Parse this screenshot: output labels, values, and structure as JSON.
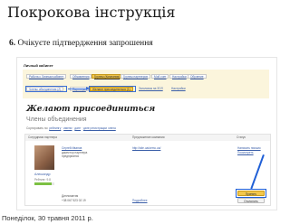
{
  "slide": {
    "title": "Покрокова інструкція",
    "step_number": "6.",
    "step_text": "Очікуєте підтвердження запрошення",
    "date": "Понеділок, 30 травня 2011 р."
  },
  "site": {
    "page_heading": "Личный кабинет",
    "menu_row1": [
      "Работа с Личным кабинет",
      "Объявления",
      "Группы (Компания)",
      "Группы партнеров",
      "Мой счет",
      "Настройки",
      "Обучение"
    ],
    "menu_row2": [
      "Члены объединения (Z)",
      "Партнеры",
      "Желают присоединиться (1)",
      "Заголовок на ЗОЛ",
      "Настройки"
    ],
    "section_title": "Желают присоединиться",
    "section_subtitle": "Члены объединения",
    "filter_label": "Сортировать по:",
    "filter_links": [
      "рейтингу",
      "имени",
      "дате",
      "дате регистрации члена"
    ],
    "table": {
      "headers": [
        "Сотрудники партнера",
        "Предложение компании",
        "Статус"
      ],
      "member": {
        "name": "Александр",
        "meta": "Рейтинг: 9.8",
        "company_title": "Сергей Иванов",
        "company_lines": [
          "директор партнера",
          "предприятия"
        ],
        "phone_label": "Дипломатия",
        "phone": "+38 067 523 02 19",
        "url": "http://site.ua/uemc.ua/",
        "details_link": "Подробнее",
        "status_links": [
          "Написать письмо",
          "Посмотреть"
        ],
        "accept_label": "Принять",
        "decline_label": "Отклонить"
      }
    }
  },
  "colors": {
    "accent": "#f3c74b",
    "highlight": "#3b6fd6",
    "link": "#3a5ea8"
  }
}
